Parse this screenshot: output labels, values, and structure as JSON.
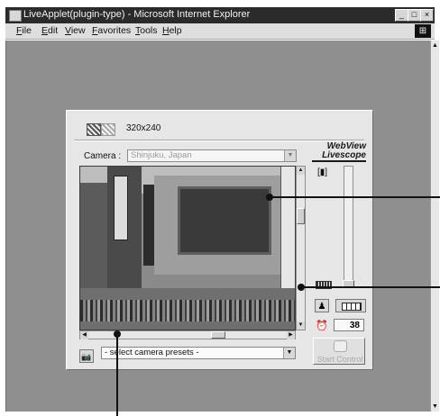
{
  "window": {
    "title": "LiveApplet(plugin-type) - Microsoft Internet Explorer",
    "minimize": "_",
    "maximize": "□",
    "close": "×"
  },
  "menu": {
    "items": [
      "File",
      "Edit",
      "View",
      "Favorites",
      "Tools",
      "Help"
    ]
  },
  "applet": {
    "resolution_label": "320x240",
    "camera_label": "Camera :",
    "camera_value": "Shinjuku, Japan",
    "logo_line1": "WebView",
    "logo_line2": "Livescope",
    "timer_value": "38",
    "start_button": "Start Control",
    "preset_value": "- select camera presets -"
  },
  "icons": {
    "window": "app-icon",
    "menu_logo": "windows-logo-icon",
    "zoom_tele": "zoom-tele-icon",
    "zoom_wide": "zoom-wide-icon",
    "backlight": "backlight-person-icon",
    "wide_view": "panorama-icon",
    "timer": "clock-icon",
    "snapshot": "camera-icon"
  }
}
